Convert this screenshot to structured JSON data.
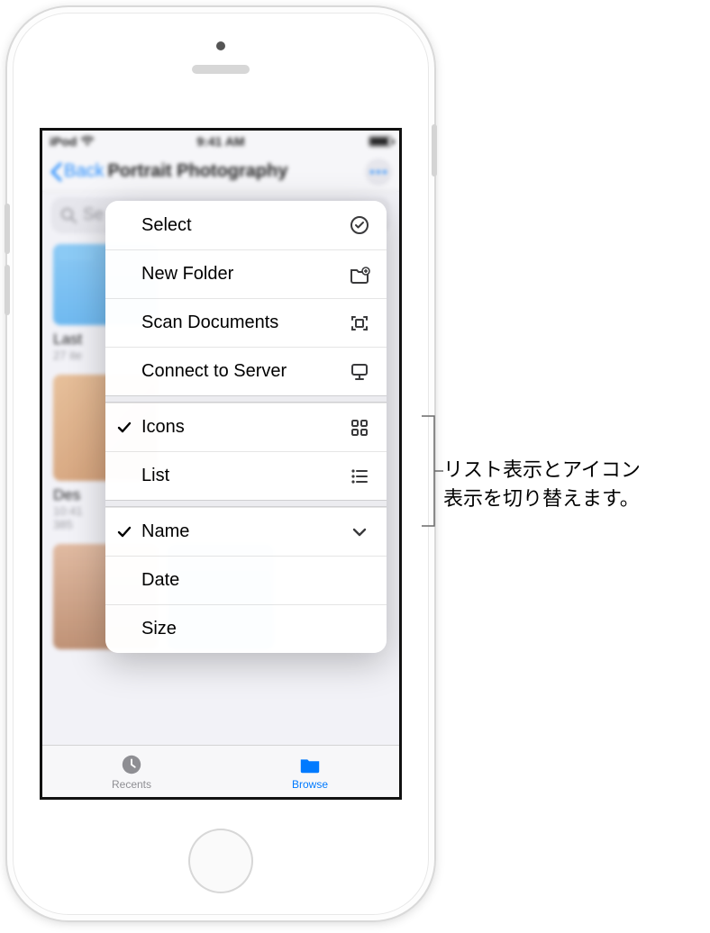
{
  "status": {
    "carrier": "iPod",
    "time": "9:41 AM"
  },
  "nav": {
    "back_label": "Back",
    "title": "Portrait Photography"
  },
  "search": {
    "placeholder_visible": "Se"
  },
  "grid": {
    "items": [
      {
        "name": "Last",
        "meta1": "27 ite"
      },
      {
        "name": "Des",
        "meta1": "10:41",
        "meta2": "385"
      }
    ]
  },
  "menu": {
    "actions": [
      {
        "label": "Select",
        "icon": "select"
      },
      {
        "label": "New Folder",
        "icon": "new-folder"
      },
      {
        "label": "Scan Documents",
        "icon": "scan"
      },
      {
        "label": "Connect to Server",
        "icon": "server"
      }
    ],
    "view": [
      {
        "label": "Icons",
        "checked": true,
        "icon": "grid"
      },
      {
        "label": "List",
        "checked": false,
        "icon": "list"
      }
    ],
    "sort": [
      {
        "label": "Name",
        "checked": true,
        "icon": "chevron"
      },
      {
        "label": "Date",
        "checked": false
      },
      {
        "label": "Size",
        "checked": false
      }
    ]
  },
  "tabbar": {
    "recents": "Recents",
    "browse": "Browse"
  },
  "callout": {
    "line1": "リスト表示とアイコン",
    "line2": "表示を切り替えます。"
  }
}
